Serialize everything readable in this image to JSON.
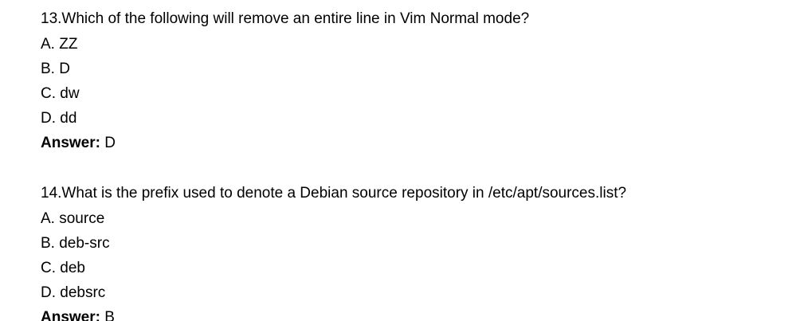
{
  "questions": [
    {
      "prompt": "13.Which of the following will remove an entire line in Vim Normal mode?",
      "options": [
        "A. ZZ",
        "B. D",
        "C. dw",
        "D. dd"
      ],
      "answer_label": "Answer:",
      "answer_value": " D"
    },
    {
      "prompt": "14.What is the prefix used to denote a Debian source repository in /etc/apt/sources.list?",
      "options": [
        "A. source",
        "B. deb-src",
        "C. deb",
        "D. debsrc"
      ],
      "answer_label": "Answer:",
      "answer_value": " B"
    }
  ]
}
